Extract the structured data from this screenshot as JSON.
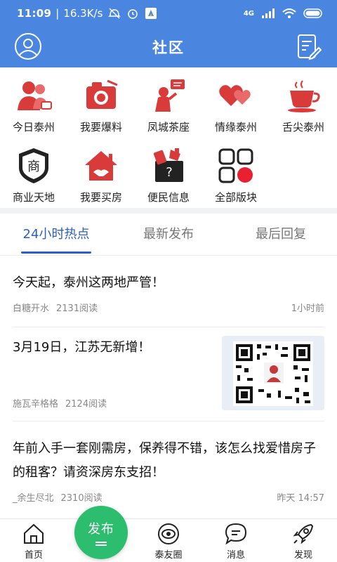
{
  "status_bar": {
    "time": "11:09",
    "speed": "16.3K/s",
    "signal": "4G",
    "icons": [
      "no-disturb-icon",
      "alarm-icon",
      "app-icon",
      "signal-icon",
      "wifi-icon",
      "battery-icon"
    ]
  },
  "header": {
    "title": "社区",
    "left_icon": "avatar-icon",
    "right_icon": "edit-note-icon",
    "background": "#4a86e0"
  },
  "categories": [
    {
      "label": "今日泰州",
      "icon": "people-icon"
    },
    {
      "label": "我要爆料",
      "icon": "camera-icon"
    },
    {
      "label": "凤城茶座",
      "icon": "speaker-icon"
    },
    {
      "label": "情缘泰州",
      "icon": "hearts-icon"
    },
    {
      "label": "舌尖泰州",
      "icon": "teacup-icon"
    },
    {
      "label": "商业天地",
      "icon": "shop-icon"
    },
    {
      "label": "我要买房",
      "icon": "house-icon"
    },
    {
      "label": "便民信息",
      "icon": "toolbox-icon"
    },
    {
      "label": "全部版块",
      "icon": "grid-icon"
    }
  ],
  "tabs": [
    {
      "label": "24小时热点",
      "active": true
    },
    {
      "label": "最新发布",
      "active": false
    },
    {
      "label": "最后回复",
      "active": false
    }
  ],
  "posts": [
    {
      "title": "今天起，泰州这两地严管！",
      "author": "白糖开水",
      "reads": "2131阅读",
      "time": "1小时前"
    },
    {
      "title": "3月19日，江苏无新增！",
      "author": "施瓦辛格格",
      "reads": "2124阅读",
      "time": "",
      "thumbnail": "qr-code-icon"
    },
    {
      "title": "年前入手一套刚需房，保养得不错，该怎么找爱惜房子的租客？请资深房东支招！",
      "author": "_余生尽北",
      "reads": "2310阅读",
      "time": "昨天 14:57"
    }
  ],
  "bottom_nav": [
    {
      "label": "首页",
      "icon": "home-icon"
    },
    {
      "label": "",
      "icon": ""
    },
    {
      "label": "泰友圈",
      "icon": "circle-eye-icon"
    },
    {
      "label": "消息",
      "icon": "message-icon"
    },
    {
      "label": "发现",
      "icon": "rocket-icon"
    }
  ],
  "fab": {
    "label": "发布",
    "color": "#2dbd6e"
  },
  "colors": {
    "accent": "#2b5fc7",
    "red": "#d93a3a"
  }
}
